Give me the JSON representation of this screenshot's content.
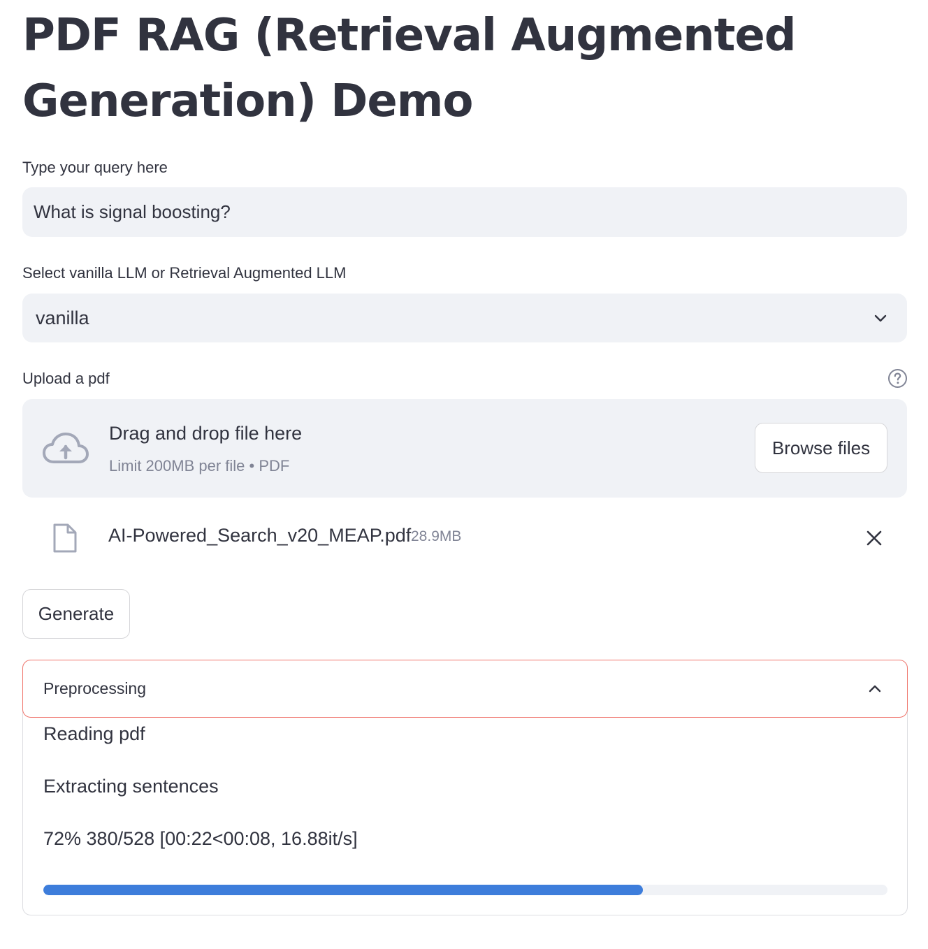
{
  "page": {
    "title": "PDF RAG (Retrieval Augmented Generation) Demo"
  },
  "query": {
    "label": "Type your query here",
    "value": "What is signal boosting?"
  },
  "mode_select": {
    "label": "Select vanilla LLM or Retrieval Augmented LLM",
    "selected": "vanilla"
  },
  "uploader": {
    "label": "Upload a pdf",
    "drop_text": "Drag and drop file here",
    "limit_text": "Limit 200MB per file • PDF",
    "browse_label": "Browse files",
    "file": {
      "name": "AI-Powered_Search_v20_MEAP.pdf",
      "size": "28.9MB"
    }
  },
  "generate": {
    "label": "Generate"
  },
  "expander": {
    "title": "Preprocessing",
    "steps": [
      "Reading pdf",
      "Extracting sentences"
    ],
    "progress_text": "72% 380/528 [00:22<00:08, 16.88it/s]",
    "progress_fraction": 0.71
  },
  "colors": {
    "accent": "#3d7ddb",
    "focus_border": "#f0756c",
    "surface": "#f0f2f6",
    "text": "#31333f",
    "muted": "#808495"
  },
  "icons": {
    "select_chevron": "chevron-down-icon",
    "help": "help-circle-icon",
    "upload": "cloud-upload-icon",
    "file": "file-icon",
    "remove": "close-icon",
    "expander_chevron": "chevron-up-icon"
  }
}
